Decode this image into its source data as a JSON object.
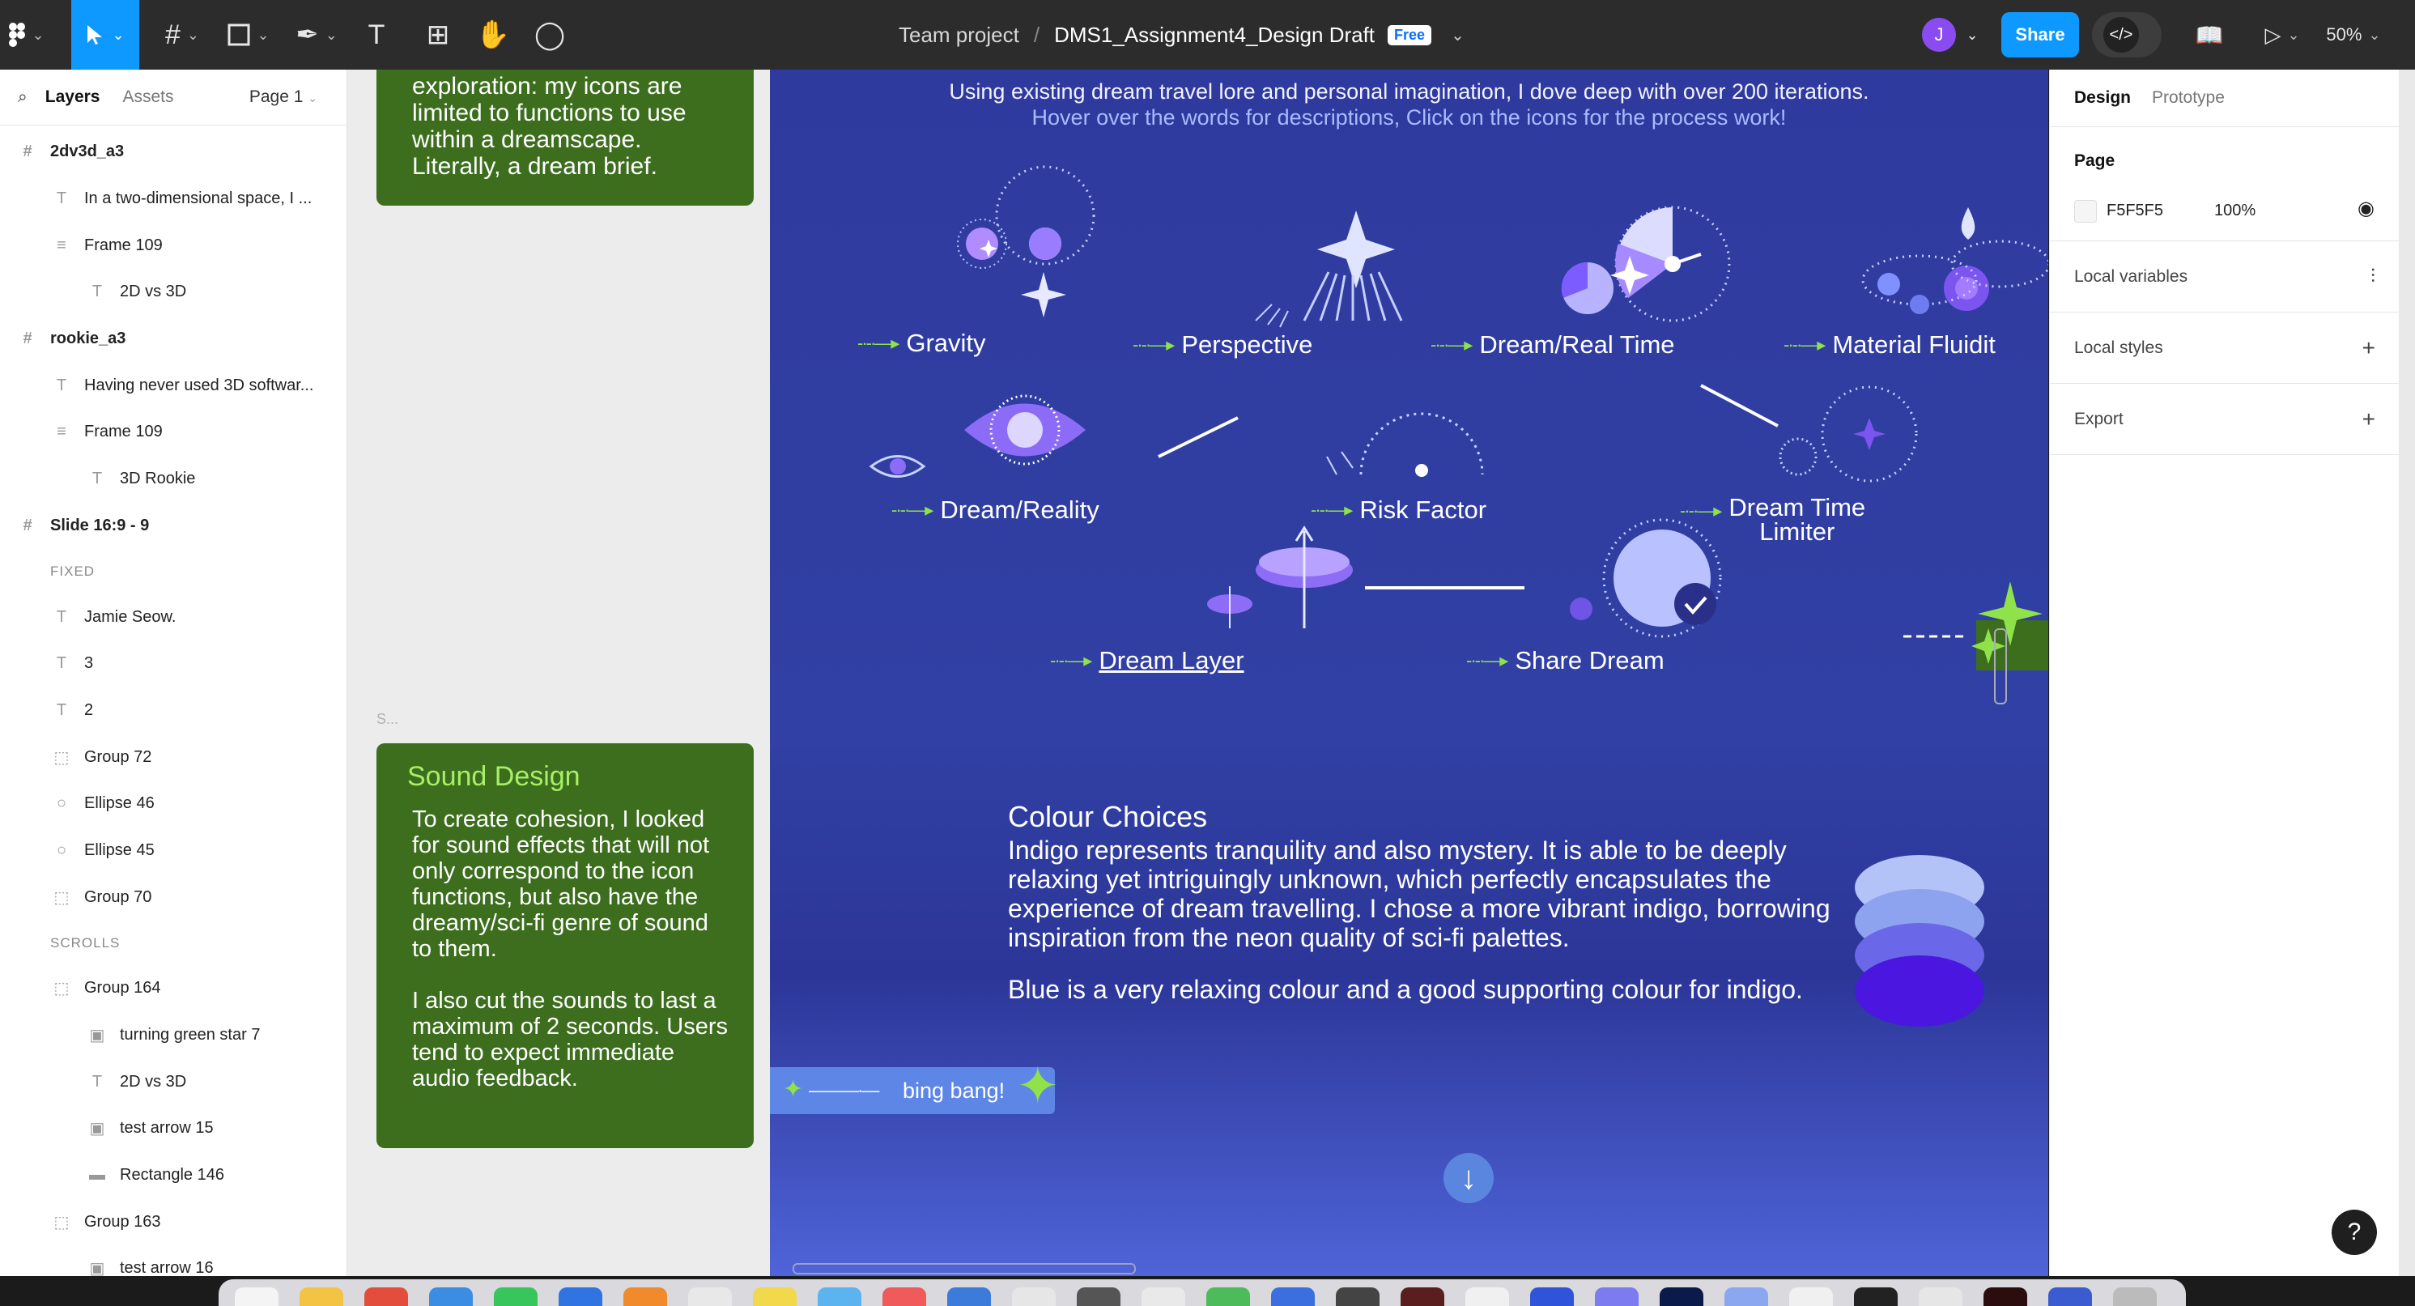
{
  "toolbar": {
    "breadcrumb_team": "Team project",
    "breadcrumb_sep": "/",
    "file_name": "DMS1_Assignment4_Design Draft",
    "plan_badge": "Free",
    "avatar_initial": "J",
    "share_label": "Share",
    "zoom": "50%"
  },
  "left_panel": {
    "tab_layers": "Layers",
    "tab_assets": "Assets",
    "page_selector": "Page 1",
    "layers": [
      {
        "label": "2dv3d_a3",
        "type": "frame"
      },
      {
        "label": "In a two-dimensional space, I ...",
        "type": "text"
      },
      {
        "label": "Frame 109",
        "type": "autolayout"
      },
      {
        "label": "2D vs 3D",
        "type": "text"
      },
      {
        "label": "rookie_a3",
        "type": "frame"
      },
      {
        "label": "Having never used 3D softwar...",
        "type": "text"
      },
      {
        "label": "Frame 109",
        "type": "autolayout"
      },
      {
        "label": "3D Rookie",
        "type": "text"
      },
      {
        "label": "Slide 16:9 - 9",
        "type": "frame"
      }
    ],
    "section_fixed": "FIXED",
    "fixed_layers": [
      {
        "label": "Jamie Seow.",
        "type": "text"
      },
      {
        "label": "3",
        "type": "text"
      },
      {
        "label": "2",
        "type": "text"
      },
      {
        "label": "Group 72",
        "type": "group"
      },
      {
        "label": "Ellipse 46",
        "type": "ellipse"
      },
      {
        "label": "Ellipse 45",
        "type": "ellipse"
      },
      {
        "label": "Group 70",
        "type": "group"
      }
    ],
    "section_scrolls": "SCROLLS",
    "scroll_layers": [
      {
        "label": "Group 164",
        "type": "group"
      },
      {
        "label": "turning green star 7",
        "type": "media"
      },
      {
        "label": "2D vs 3D",
        "type": "text"
      },
      {
        "label": "test arrow 15",
        "type": "media"
      },
      {
        "label": "Rectangle 146",
        "type": "rect"
      },
      {
        "label": "Group 163",
        "type": "group"
      },
      {
        "label": "test arrow 16",
        "type": "media"
      }
    ]
  },
  "canvas": {
    "card_top_text": "exploration: my icons are limited to functions to use within a dreamscape. Literally, a dream brief.",
    "small_label": "S...",
    "sound_title": "Sound Design",
    "sound_p1": "To create cohesion, I looked for sound effects that will not only correspond to the icon functions, but also have the dreamy/sci-fi genre of sound to them.",
    "sound_p2": "I also cut the sounds to last a maximum of 2 seconds. Users tend to expect immediate audio feedback.",
    "intro_line1": "Using existing dream travel lore and personal imagination, I dove deep with over 200 iterations.",
    "intro_line2": "Hover over the words for descriptions, Click on the icons for the process work!",
    "icons": {
      "gravity": "Gravity",
      "perspective": "Perspective",
      "dream_real_time": "Dream/Real Time",
      "material_fluidity": "Material Fluidit",
      "dream_reality": "Dream/Reality",
      "risk_factor": "Risk Factor",
      "dream_time_limiter_1": "Dream Time",
      "dream_time_limiter_2": "Limiter",
      "dream_layer": "Dream Layer",
      "share_dream": "Share Dream"
    },
    "colour_title": "Colour Choices",
    "colour_p1": "Indigo represents tranquility and also mystery. It is able to be deeply relaxing yet intriguingly unknown, which perfectly encapsulates the experience of dream travelling. I chose a more vibrant indigo, borrowing inspiration from the neon quality of sci-fi palettes.",
    "colour_p2": "Blue is a very relaxing colour and a good supporting colour for indigo.",
    "bing_bang": "bing bang!"
  },
  "right_panel": {
    "tab_design": "Design",
    "tab_prototype": "Prototype",
    "page_heading": "Page",
    "page_color_hex": "F5F5F5",
    "page_opacity": "100%",
    "local_variables": "Local variables",
    "local_styles": "Local styles",
    "export": "Export"
  },
  "help": "?",
  "colors": {
    "accent": "#0d99ff",
    "card_green": "#3c6e1e",
    "board_indigo": "#3140a4",
    "star_green": "#8fe24a"
  }
}
